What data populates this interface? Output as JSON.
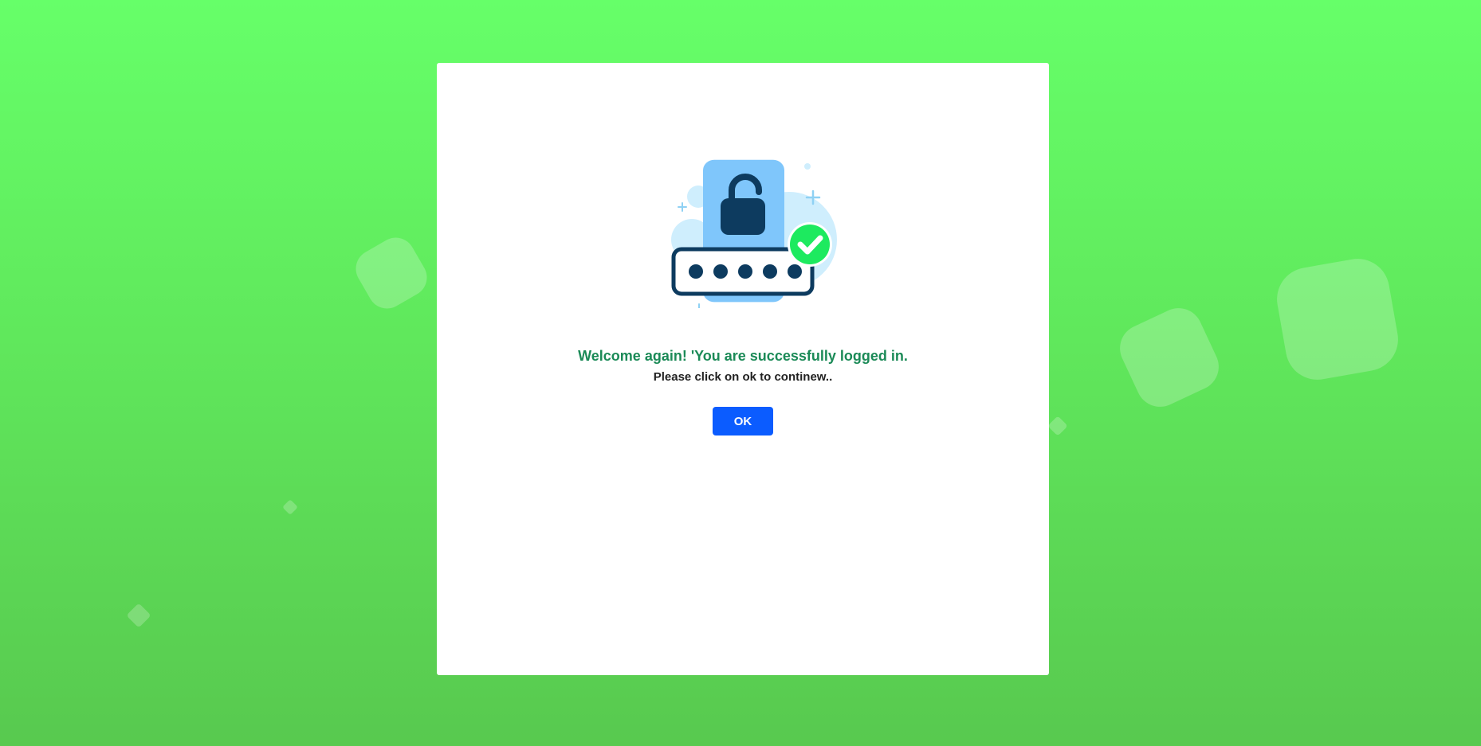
{
  "dialog": {
    "title": "Welcome again! 'You are successfully logged in.",
    "message": "Please click on ok to continew..",
    "ok_label": "OK"
  },
  "illustration": {
    "icon": "unlocked-padlock-password-success-icon"
  },
  "colors": {
    "background_top": "#66ff69",
    "background_bottom": "#58c94f",
    "title": "#1b8a57",
    "button": "#0b5cff",
    "check": "#1dea5f",
    "lock": "#0d3b5f",
    "phone": "#7fc6fb"
  }
}
